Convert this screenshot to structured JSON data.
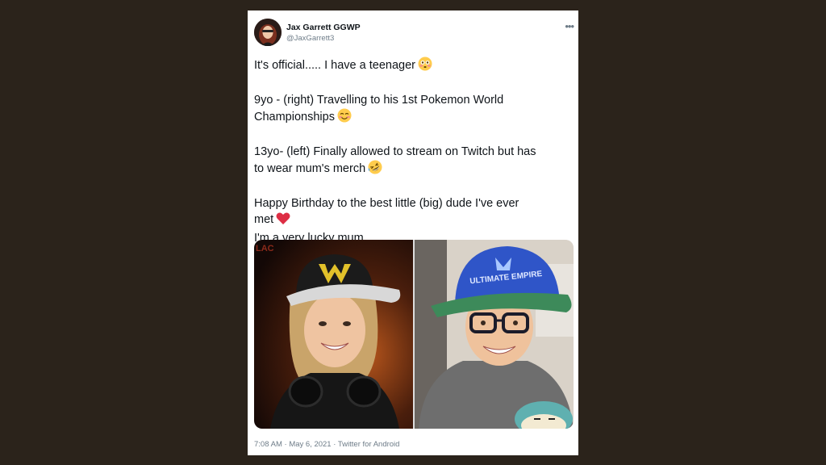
{
  "tweet": {
    "display_name": "Jax Garrett GGWP",
    "handle": "@JaxGarrett3",
    "more_icon": "more-horizontal-icon",
    "lines": {
      "l1": "It's official..... I have a teenager",
      "l2": "9yo - (right) Travelling to his 1st Pokemon World",
      "l3": "Championships",
      "l4": "13yo- (left) Finally allowed to stream on Twitch but has",
      "l5": "to wear mum's merch",
      "l6": "Happy Birthday to the best little (big) dude I've ever",
      "l7": "met",
      "l8": "I'm a very lucky mum."
    },
    "emojis": [
      "flushed-face-emoji",
      "smiling-face-emoji",
      "rolling-laughing-emoji",
      "red-heart-emoji"
    ],
    "media": {
      "left_cap_text": "LAC",
      "right_cap_text": "ULTIMATE EMPIRE"
    },
    "footer": {
      "time": "7:08 AM",
      "sep1": " · ",
      "date": "May 6, 2021",
      "sep2": " · ",
      "source": "Twitter for Android"
    }
  },
  "colors": {
    "background": "#2b231b",
    "card": "#ffffff",
    "text": "#0f1419",
    "muted": "#6e7c88",
    "heart": "#e0245e"
  }
}
